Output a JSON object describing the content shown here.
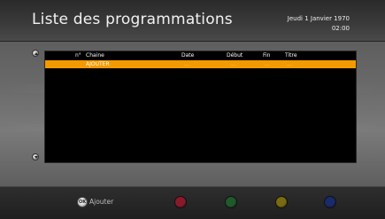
{
  "header": {
    "title": "Liste des programmations",
    "date": "Jeudi 1 Janvier 1970",
    "time": "02:00"
  },
  "table": {
    "columns": {
      "num": "n°",
      "channel": "Chaine",
      "date": "Date",
      "start": "Début",
      "end": "Fin",
      "title": "Titre"
    },
    "rows": [
      {
        "channel": "AJOUTER",
        "date": "...",
        "start": "...",
        "end": "...",
        "title": "..."
      }
    ]
  },
  "footer": {
    "ok_label": "Ajouter",
    "ok_button_text": "OK",
    "color_keys": [
      {
        "name": "red",
        "color": "#8a1a2a"
      },
      {
        "name": "green",
        "color": "#1f5a2a"
      },
      {
        "name": "yellow",
        "color": "#7a6a10"
      },
      {
        "name": "blue",
        "color": "#1a2a6a"
      }
    ]
  },
  "colors": {
    "accent": "#f29a00",
    "panel_bg": "#000000"
  }
}
